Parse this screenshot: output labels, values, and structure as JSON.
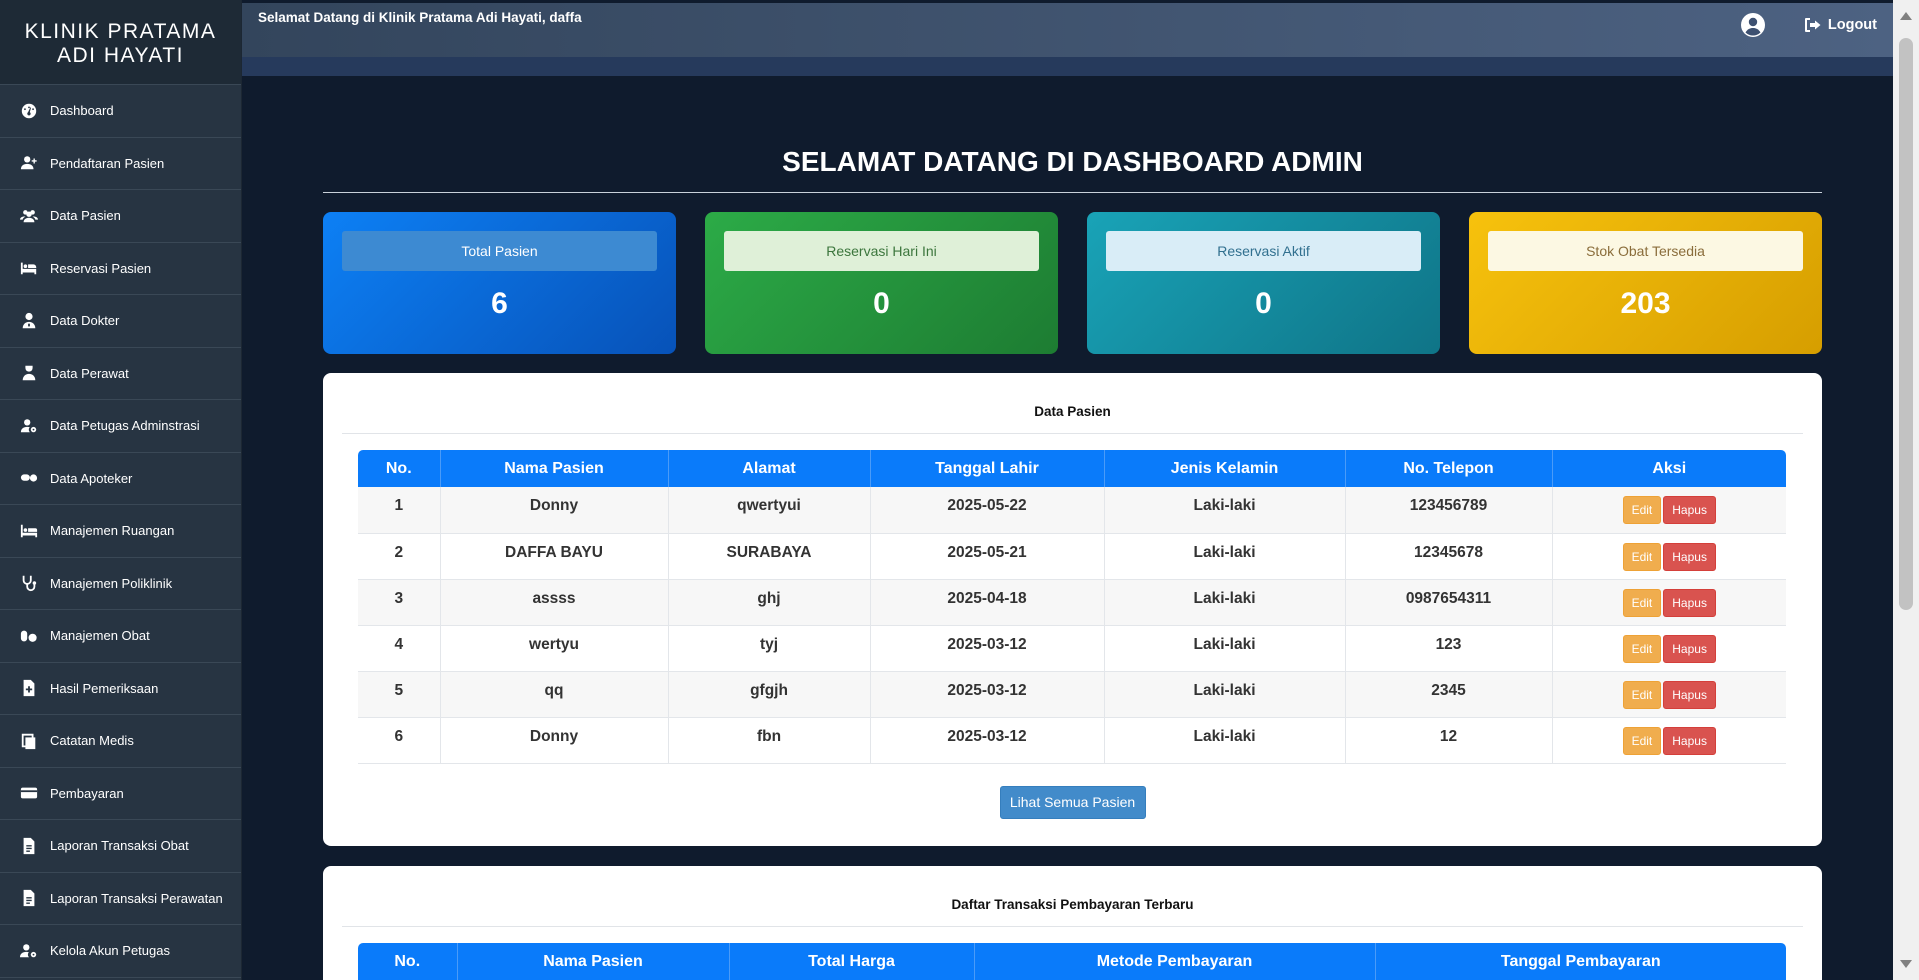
{
  "brand": {
    "line1": "KLINIK PRATAMA",
    "line2": "ADI HAYATI"
  },
  "topbar": {
    "welcome": "Selamat Datang di Klinik Pratama Adi Hayati, daffa",
    "logout": "Logout"
  },
  "sidebar": {
    "items": [
      {
        "label": "Dashboard",
        "icon": "dashboard-icon"
      },
      {
        "label": "Pendaftaran Pasien",
        "icon": "user-plus-icon"
      },
      {
        "label": "Data Pasien",
        "icon": "users-icon"
      },
      {
        "label": "Reservasi Pasien",
        "icon": "bed-icon"
      },
      {
        "label": "Data Dokter",
        "icon": "doctor-icon"
      },
      {
        "label": "Data Perawat",
        "icon": "nurse-icon"
      },
      {
        "label": "Data Petugas Adminstrasi",
        "icon": "user-gear-icon"
      },
      {
        "label": "Data Apoteker",
        "icon": "pills-icon"
      },
      {
        "label": "Manajemen Ruangan",
        "icon": "room-bed-icon"
      },
      {
        "label": "Manajemen Poliklinik",
        "icon": "stethoscope-icon"
      },
      {
        "label": "Manajemen Obat",
        "icon": "capsules-icon"
      },
      {
        "label": "Hasil Pemeriksaan",
        "icon": "file-medical-icon"
      },
      {
        "label": "Catatan Medis",
        "icon": "notes-icon"
      },
      {
        "label": "Pembayaran",
        "icon": "credit-card-icon"
      },
      {
        "label": "Laporan Transaksi Obat",
        "icon": "document-icon"
      },
      {
        "label": "Laporan Transaksi Perawatan",
        "icon": "document-icon"
      },
      {
        "label": "Kelola Akun Petugas",
        "icon": "users-gear-icon"
      }
    ]
  },
  "main": {
    "title": "SELAMAT DATANG DI DASHBOARD ADMIN",
    "cards": [
      {
        "label": "Total Pasien",
        "value": "6"
      },
      {
        "label": "Reservasi Hari Ini",
        "value": "0"
      },
      {
        "label": "Reservasi Aktif",
        "value": "0"
      },
      {
        "label": "Stok Obat Tersedia",
        "value": "203"
      }
    ],
    "patients": {
      "title": "Data Pasien",
      "headers": [
        "No.",
        "Nama Pasien",
        "Alamat",
        "Tanggal Lahir",
        "Jenis Kelamin",
        "No. Telepon",
        "Aksi"
      ],
      "rows": [
        [
          "1",
          "Donny",
          "qwertyui",
          "2025-05-22",
          "Laki-laki",
          "123456789"
        ],
        [
          "2",
          "DAFFA BAYU",
          "SURABAYA",
          "2025-05-21",
          "Laki-laki",
          "12345678"
        ],
        [
          "3",
          "assss",
          "ghj",
          "2025-04-18",
          "Laki-laki",
          "0987654311"
        ],
        [
          "4",
          "wertyu",
          "tyj",
          "2025-03-12",
          "Laki-laki",
          "123"
        ],
        [
          "5",
          "qq",
          "gfgjh",
          "2025-03-12",
          "Laki-laki",
          "2345"
        ],
        [
          "6",
          "Donny",
          "fbn",
          "2025-03-12",
          "Laki-laki",
          "12"
        ]
      ],
      "edit_label": "Edit",
      "delete_label": "Hapus",
      "see_all": "Lihat Semua Pasien"
    },
    "transactions": {
      "title": "Daftar Transaksi Pembayaran Terbaru",
      "headers": [
        "No.",
        "Nama Pasien",
        "Total Harga",
        "Metode Pembayaran",
        "Tanggal Pembayaran"
      ]
    }
  },
  "colors": {
    "primary": "#0a7bfa",
    "success": "#2cab47",
    "info": "#19a3b7",
    "warning": "#f7c20d",
    "sidebar": "#273442"
  }
}
